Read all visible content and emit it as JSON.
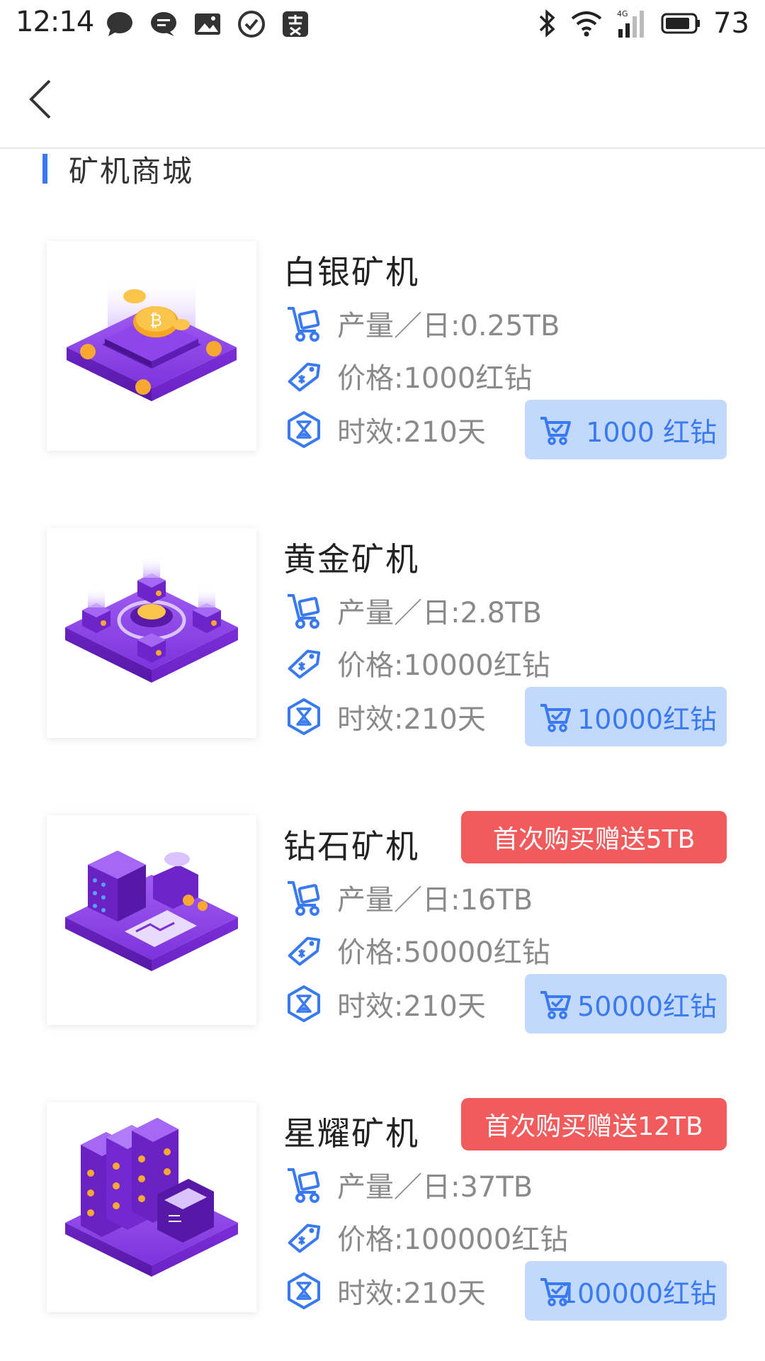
{
  "status_bar": {
    "time": "12:14",
    "battery": "73",
    "network": "4G"
  },
  "section": {
    "title": "矿机商城"
  },
  "products": [
    {
      "name": "白银矿机",
      "output": "产量／日:0.25TB",
      "price": "价格:1000红钻",
      "duration": "时效:210天",
      "buy_label": "1000 红钻",
      "promo": ""
    },
    {
      "name": "黄金矿机",
      "output": "产量／日:2.8TB",
      "price": "价格:10000红钻",
      "duration": "时效:210天",
      "buy_label": "10000红钻",
      "promo": ""
    },
    {
      "name": "钻石矿机",
      "output": "产量／日:16TB",
      "price": "价格:50000红钻",
      "duration": "时效:210天",
      "buy_label": "50000红钻",
      "promo": "首次购买赠送5TB"
    },
    {
      "name": "星耀矿机",
      "output": "产量／日:37TB",
      "price": "价格:100000红钻",
      "duration": "时效:210天",
      "buy_label": "100000红钻",
      "promo": "首次购买赠送12TB"
    }
  ],
  "colors": {
    "accent": "#3a7af0",
    "button_bg": "#c3d9fb",
    "promo_bg": "#f15b5c",
    "product_purple": "#7b2fd6"
  },
  "icons": {
    "output": "cart-trolley-icon",
    "price": "price-tag-icon",
    "duration": "hourglass-icon",
    "buy": "shopping-cart-icon"
  }
}
